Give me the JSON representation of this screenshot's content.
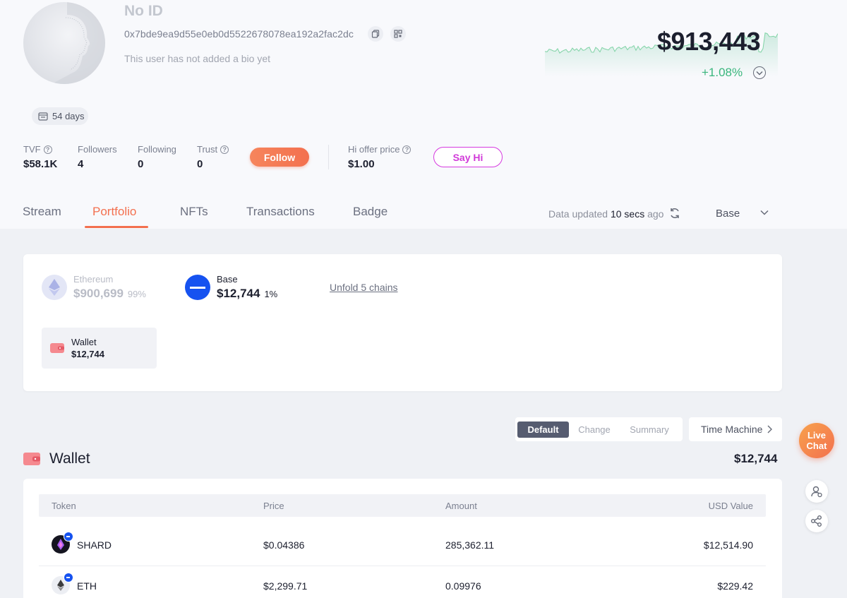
{
  "profile": {
    "name": "No ID",
    "address": "0x7bde9ea9d55e0eb0d5522678078ea192a2fac2dc",
    "bio": "This user has not added a bio yet",
    "days": "54 days"
  },
  "stats": {
    "tvf_label": "TVF",
    "tvf_value": "$58.1K",
    "followers_label": "Followers",
    "followers_value": "4",
    "following_label": "Following",
    "following_value": "0",
    "trust_label": "Trust",
    "trust_value": "0",
    "follow_button": "Follow",
    "hi_label": "Hi offer price",
    "hi_value": "$1.00",
    "sayhi_button": "Say Hi"
  },
  "net_worth": {
    "value": "$913,443",
    "change": "+1.08%",
    "change_color": "#3ab67d"
  },
  "tabs": [
    {
      "label": "Stream"
    },
    {
      "label": "Portfolio",
      "active": true
    },
    {
      "label": "NFTs"
    },
    {
      "label": "Transactions"
    },
    {
      "label": "Badge"
    }
  ],
  "data_status": {
    "prefix": "Data updated",
    "time": "10 secs",
    "suffix": "ago",
    "chain": "Base"
  },
  "chains": [
    {
      "name": "Ethereum",
      "value": "$900,699",
      "pct": "99%",
      "icon": "ethereum-icon",
      "dimmed": true
    },
    {
      "name": "Base",
      "value": "$12,744",
      "pct": "1%",
      "icon": "base-icon",
      "dimmed": false
    }
  ],
  "unfold": "Unfold 5 chains",
  "wallet_tile": {
    "label": "Wallet",
    "value": "$12,744"
  },
  "views": {
    "options": [
      "Default",
      "Change",
      "Summary"
    ],
    "active": "Default",
    "time_machine": "Time Machine"
  },
  "wallet": {
    "title": "Wallet",
    "total": "$12,744",
    "columns": [
      "Token",
      "Price",
      "Amount",
      "USD Value"
    ],
    "rows": [
      {
        "token": "SHARD",
        "price": "$0.04386",
        "amount": "285,362.11",
        "usd": "$12,514.90"
      },
      {
        "token": "ETH",
        "price": "$2,299.71",
        "amount": "0.09976",
        "usd": "$229.42"
      }
    ]
  },
  "live_chat": {
    "line1": "Live",
    "line2": "Chat"
  },
  "colors": {
    "accent": "#f3704f",
    "say_hi": "#d13ad9",
    "base_blue": "#1652f0",
    "positive": "#3ab67d"
  }
}
